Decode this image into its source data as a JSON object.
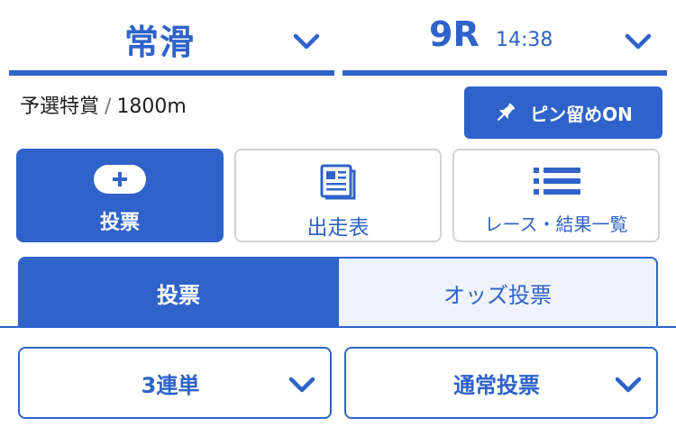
{
  "header": {
    "venue": "常滑",
    "race_number": "9R",
    "race_time": "14:38"
  },
  "race_info": {
    "grade": "予選特賞",
    "separator": "/",
    "distance": "1800m"
  },
  "pin_button": {
    "label": "ピン留めON"
  },
  "nav": {
    "bet": "投票",
    "entries": "出走表",
    "results": "レース・結果一覧"
  },
  "tabs": [
    {
      "label": "投票",
      "active": true
    },
    {
      "label": "オッズ投票",
      "active": false
    }
  ],
  "bet_type": {
    "selected": "3連単"
  },
  "bet_mode": {
    "selected": "通常投票"
  },
  "colors": {
    "accent": "#2f63c9",
    "tab_inactive_bg": "#edf2fb",
    "card_border": "#d3d3d3"
  },
  "icons": [
    "chevron-down-icon",
    "pin-icon",
    "plus-icon",
    "newspaper-icon",
    "list-icon"
  ]
}
